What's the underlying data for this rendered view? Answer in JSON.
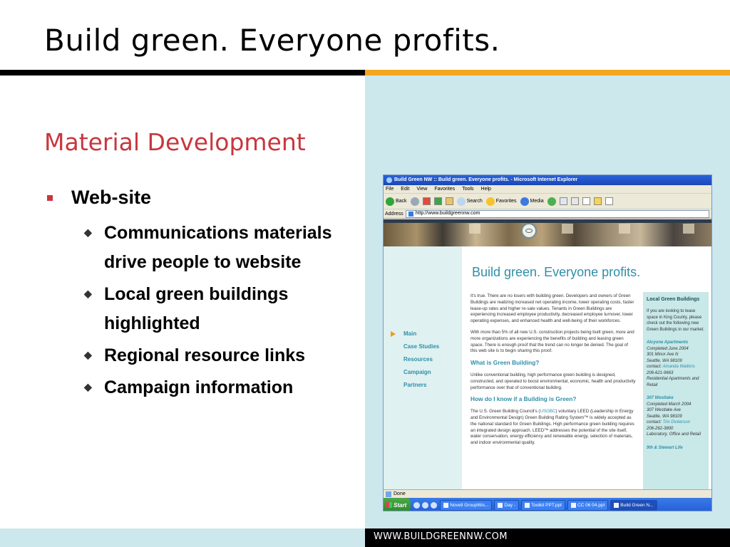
{
  "slide": {
    "title": "Build green. Everyone profits.",
    "section_heading": "Material Development",
    "bullet": "Web-site",
    "sub_bullets": [
      "Communications materials drive people to website",
      "Local green buildings highlighted",
      "Regional resource links",
      "Campaign information"
    ],
    "footer_url": "WWW.BUILDGREENNW.COM"
  },
  "browser": {
    "window_title": "Build Green NW :: Build green. Everyone profits. - Microsoft Internet Explorer",
    "menu": [
      "File",
      "Edit",
      "View",
      "Favorites",
      "Tools",
      "Help"
    ],
    "toolbar": {
      "back": "Back",
      "search": "Search",
      "favorites": "Favorites",
      "media": "Media"
    },
    "address_label": "Address",
    "address_value": "http://www.buildgreennw.com",
    "status": "Done",
    "taskbar": {
      "start": "Start",
      "tasks": [
        "Novell GroupWis...",
        "Day -",
        "Toolkit PPT.ppt",
        "CC 06 04.ppt",
        "Build Green N..."
      ]
    }
  },
  "website": {
    "title": "Build green. Everyone profits.",
    "nav": [
      "Main",
      "Case Studies",
      "Resources",
      "Campaign",
      "Partners"
    ],
    "para1": "It's true. There are no losers with building green. Developers and owners of Green Buildings are realizing increased net operating income, lower operating costs, faster lease-up rates and higher re-sale values. Tenants in Green Buildings are experiencing increased employee productivity, decreased employee turnover, lower operating expenses, and enhanced health and well-being of their workforces.",
    "para2": "With more than 5% of all new U.S. construction projects being built green, more and more organizations are experiencing the benefits of building and leasing green space. There is enough proof that the trend can no longer be denied. The goal of this web site is to begin sharing this proof.",
    "h_what": "What is Green Building?",
    "para3": "Unlike conventional building, high performance green building is designed, constructed, and operated to boost environmental, economic, health and productivity performance over that of conventional building.",
    "h_how": "How do I know if a Building is Green?",
    "para4_pre": "The U.S. Green Building Council's (",
    "para4_link": "USGBC",
    "para4_post": ") voluntary LEED (Leadership in Energy and Environmental Design) Green Building Rating System™ is widely accepted as the national standard for Green Buildings. High performance green building requires an integrated design approach. LEED™ addresses the potential of the site itself, water conservation, energy efficiency and renewable energy, selection of materials, and indoor environmental quality.",
    "sidebar": {
      "heading": "Local Green Buildings",
      "intro": "If you are looking to lease space in King County, please check out the following new Green Buildings in our market.",
      "entries": [
        {
          "name": "Alcyone Apartments",
          "l1": "Completed June 2004",
          "l2": "301 Minor Ave N",
          "l3": "Seattle, WA 98109",
          "contact_label": "contact: ",
          "contact": "Amanda Watkins",
          "phone": "206-621-9663",
          "type": "Residential Apartments and Retail"
        },
        {
          "name": "307 Westlake",
          "l1": "Completed March 2004",
          "l2": "307 Westlake Ave",
          "l3": "Seattle, WA 98109",
          "contact_label": "contact: ",
          "contact": "Tim Dickerson",
          "phone": "206-262-3800",
          "type": "Laboratory, Office and Retail"
        }
      ],
      "cut": "9th & Stewart Life"
    }
  }
}
